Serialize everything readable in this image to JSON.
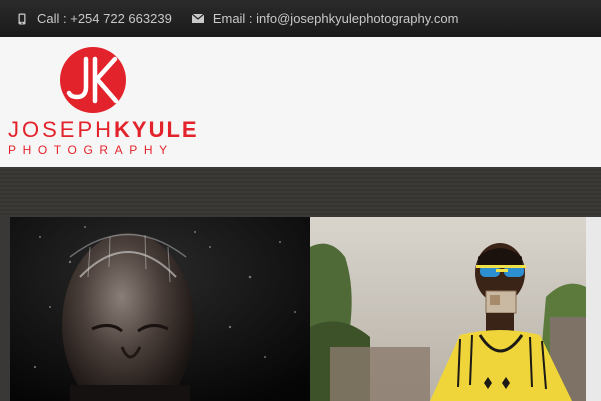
{
  "topbar": {
    "phone_icon": "phone-icon",
    "phone_text": "Call : +254 722 663239",
    "email_icon": "envelope-icon",
    "email_text": "Email : info@josephkyulephotography.com"
  },
  "logo": {
    "monogram": "JK",
    "name_light": "JOSEPH",
    "name_bold": "KYULE",
    "subtitle": "PHOTOGRAPHY"
  },
  "colors": {
    "brand_red": "#e3232c",
    "topbar_bg": "#1f1f1f",
    "header_bg": "#f6f6f6",
    "band_bg": "#3a3836"
  },
  "gallery": {
    "photos": [
      "portrait-water-splash",
      "portrait-sunglasses-banknote"
    ]
  }
}
